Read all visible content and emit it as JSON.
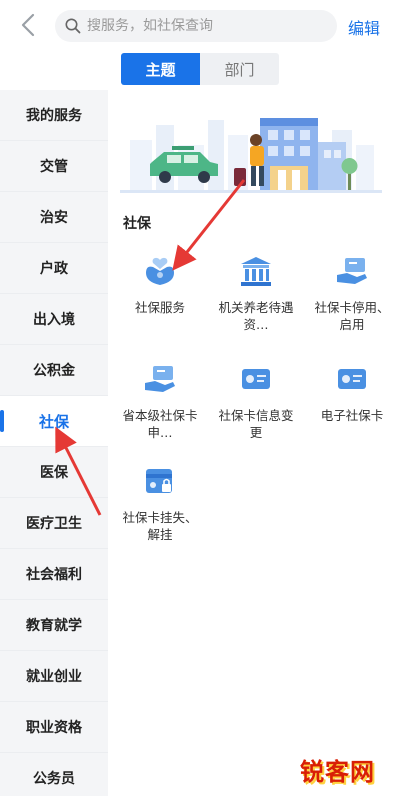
{
  "header": {
    "search_placeholder": "搜服务，如社保查询",
    "edit_label": "编辑"
  },
  "tabs": [
    {
      "label": "主题",
      "active": true
    },
    {
      "label": "部门",
      "active": false
    }
  ],
  "sidebar": {
    "items": [
      {
        "label": "我的服务"
      },
      {
        "label": "交管"
      },
      {
        "label": "治安"
      },
      {
        "label": "户政"
      },
      {
        "label": "出入境"
      },
      {
        "label": "公积金"
      },
      {
        "label": "社保",
        "active": true
      },
      {
        "label": "医保"
      },
      {
        "label": "医疗卫生"
      },
      {
        "label": "社会福利"
      },
      {
        "label": "教育就学"
      },
      {
        "label": "就业创业"
      },
      {
        "label": "职业资格"
      },
      {
        "label": "公务员"
      }
    ]
  },
  "section": {
    "title": "社保",
    "services": [
      {
        "label": "社保服务",
        "icon": "hands-heart-icon"
      },
      {
        "label": "机关养老待遇资…",
        "icon": "bank-building-icon"
      },
      {
        "label": "社保卡停用、启用",
        "icon": "hand-card-icon"
      },
      {
        "label": "省本级社保卡申…",
        "icon": "hand-card-icon"
      },
      {
        "label": "社保卡信息变更",
        "icon": "social-card-icon"
      },
      {
        "label": "电子社保卡",
        "icon": "social-card-icon"
      },
      {
        "label": "社保卡挂失、解挂",
        "icon": "card-lock-icon"
      }
    ]
  },
  "watermark": {
    "text": "锐客网"
  },
  "colors": {
    "accent": "#1a73e8",
    "annotation_arrow": "#e53935"
  }
}
